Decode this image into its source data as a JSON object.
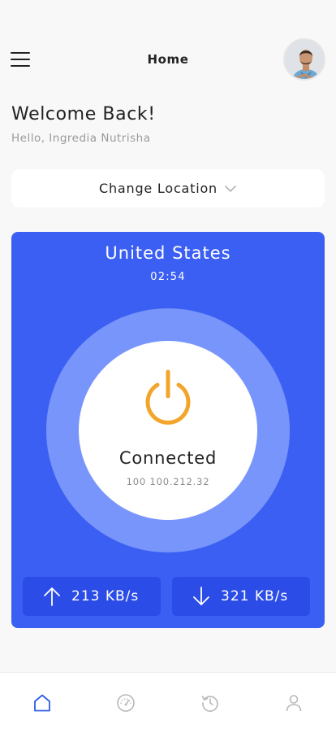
{
  "header": {
    "title": "Home",
    "menu_icon": "hamburger-menu-icon",
    "avatar": "user-avatar"
  },
  "welcome": {
    "heading": "Welcome Back!",
    "greeting": "Hello, Ingredia Nutrisha"
  },
  "location": {
    "label": "Change Location",
    "icon": "chevron-down-icon"
  },
  "connection": {
    "country": "United States",
    "timer": "02:54",
    "status": "Connected",
    "ip": "100 100.212.32",
    "upload": "213 KB/s",
    "download": "321 KB/s",
    "power_icon": "power-icon"
  },
  "colors": {
    "card": "#3b5ff2",
    "ring": "#7895fb",
    "speed_box": "#2b4ce6",
    "power": "#f3a52b",
    "nav_active": "#2f5be5",
    "nav_inactive": "#b8b8b8"
  },
  "bottom_nav": [
    {
      "name": "home",
      "icon": "home-icon",
      "active": true
    },
    {
      "name": "speed",
      "icon": "speedometer-icon",
      "active": false
    },
    {
      "name": "history",
      "icon": "history-icon",
      "active": false
    },
    {
      "name": "profile",
      "icon": "user-icon",
      "active": false
    }
  ]
}
